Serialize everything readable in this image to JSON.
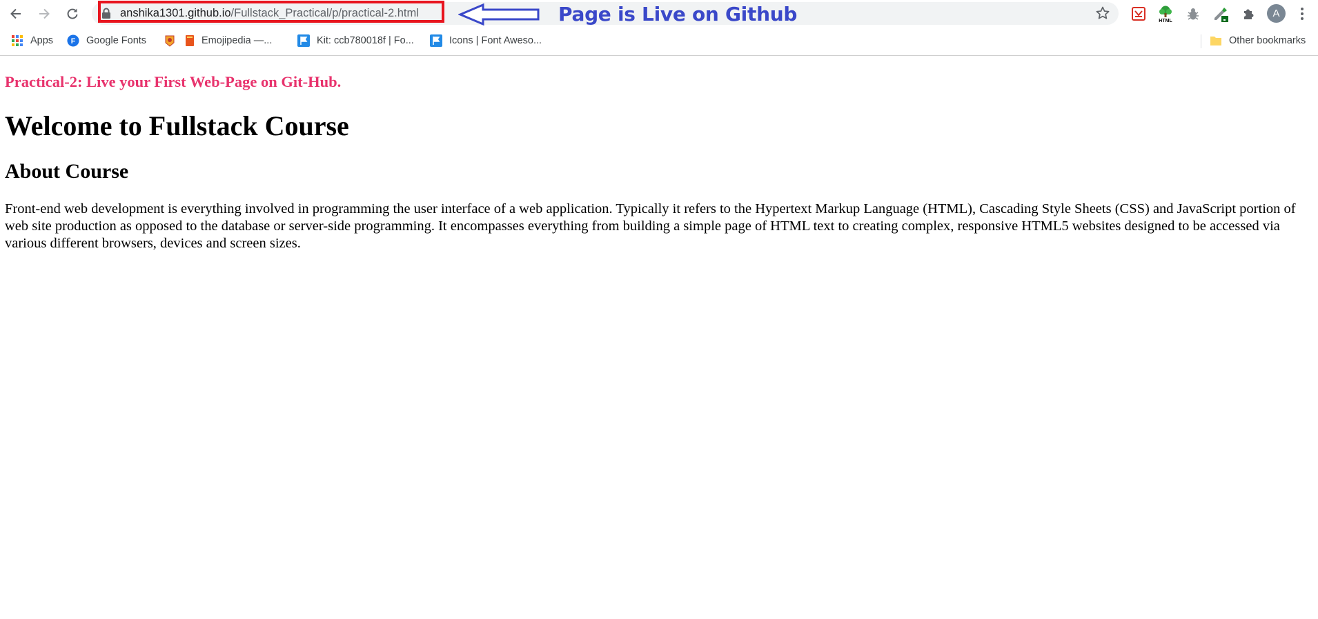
{
  "browser": {
    "url_host": "anshika1301.github.io",
    "url_path": "/Fullstack_Practical/p/practical-2.html",
    "avatar_initial": "A",
    "extensions": [
      "pdf-icon",
      "html-tree-icon",
      "bug-icon",
      "eyedropper-icon",
      "puzzle-icon"
    ]
  },
  "annotation": {
    "label": "Page is Live on Github",
    "highlight_color": "#e8151f",
    "text_color": "#3a48c9"
  },
  "bookmarks": {
    "items": [
      {
        "label": "Apps",
        "icon": "apps-grid-icon"
      },
      {
        "label": "Google Fonts",
        "icon": "google-fonts-icon"
      },
      {
        "label": "",
        "icon": "bookmark-favicon-icon"
      },
      {
        "label": "Emojipedia —...",
        "icon": "emojipedia-icon"
      },
      {
        "label": "Kit: ccb780018f | Fo...",
        "icon": "font-awesome-flag-icon"
      },
      {
        "label": "Icons | Font Aweso...",
        "icon": "font-awesome-flag-icon"
      }
    ],
    "other_label": "Other bookmarks"
  },
  "page": {
    "practical_title": "Practical-2: Live your First Web-Page on Git-Hub.",
    "heading": "Welcome to Fullstack Course",
    "subheading": "About Course",
    "paragraph": "Front-end web development is everything involved in programming the user interface of a web application. Typically it refers to the Hypertext Markup Language (HTML), Cascading Style Sheets (CSS) and JavaScript portion of web site production as opposed to the database or server-side programming. It encompasses everything from building a simple page of HTML text to creating complex, responsive HTML5 websites designed to be accessed via various different browsers, devices and screen sizes.",
    "title_color": "#e8336d"
  }
}
